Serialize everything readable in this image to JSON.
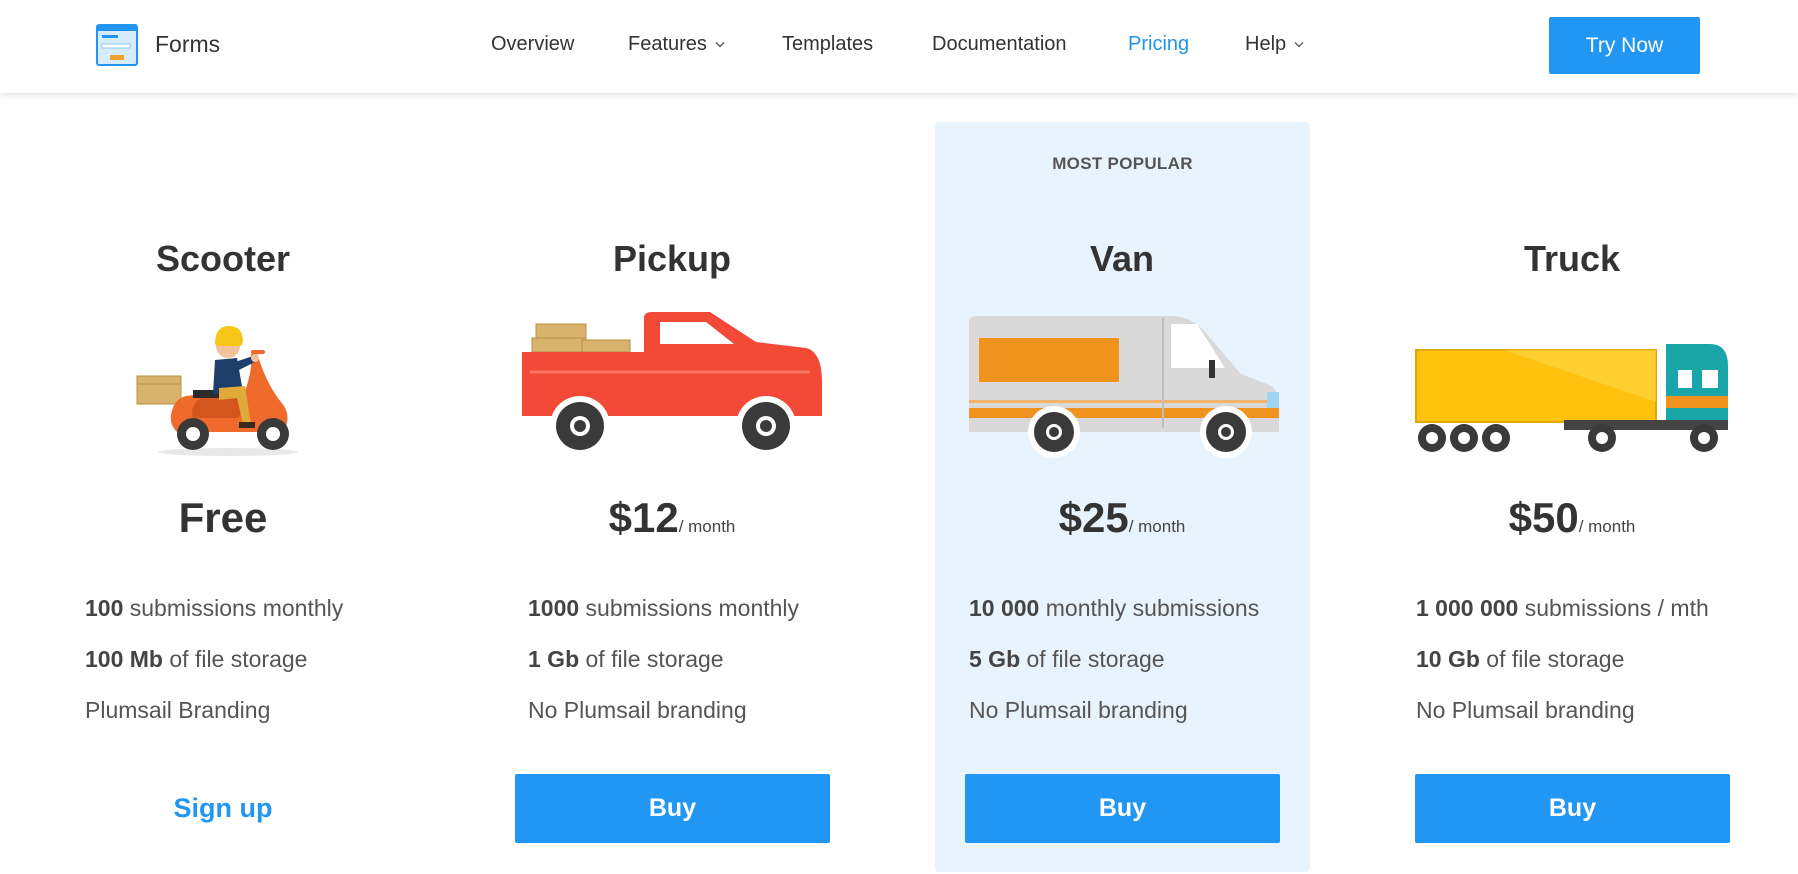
{
  "header": {
    "brand": "Forms",
    "nav": [
      {
        "label": "Overview"
      },
      {
        "label": "Features"
      },
      {
        "label": "Templates"
      },
      {
        "label": "Documentation"
      },
      {
        "label": "Pricing"
      },
      {
        "label": "Help"
      }
    ],
    "cta_label": "Try Now",
    "active_nav": "Pricing",
    "accent_color": "#2196f3"
  },
  "popular_label": "MOST POPULAR",
  "plans": [
    {
      "name": "Scooter",
      "price": "Free",
      "period": "",
      "features": [
        {
          "bold": "100",
          "text": " submissions monthly"
        },
        {
          "bold": "100 Mb",
          "text": " of file storage"
        },
        {
          "bold": "",
          "text": "Plumsail Branding"
        }
      ],
      "action_label": "Sign up"
    },
    {
      "name": "Pickup",
      "price": "$12",
      "period": "/ month",
      "features": [
        {
          "bold": "1000",
          "text": " submissions monthly"
        },
        {
          "bold": "1 Gb",
          "text": " of file storage"
        },
        {
          "bold": "",
          "text": "No Plumsail branding"
        }
      ],
      "action_label": "Buy"
    },
    {
      "name": "Van",
      "price": "$25",
      "period": "/ month",
      "features": [
        {
          "bold": "10 000",
          "text": " monthly submissions"
        },
        {
          "bold": "5 Gb",
          "text": " of file storage"
        },
        {
          "bold": "",
          "text": "No Plumsail branding"
        }
      ],
      "action_label": "Buy"
    },
    {
      "name": "Truck",
      "price": "$50",
      "period": "/ month",
      "features": [
        {
          "bold": "1 000 000",
          "text": " submissions / mth"
        },
        {
          "bold": "10 Gb",
          "text": " of file storage"
        },
        {
          "bold": "",
          "text": "No Plumsail branding"
        }
      ],
      "action_label": "Buy"
    }
  ]
}
